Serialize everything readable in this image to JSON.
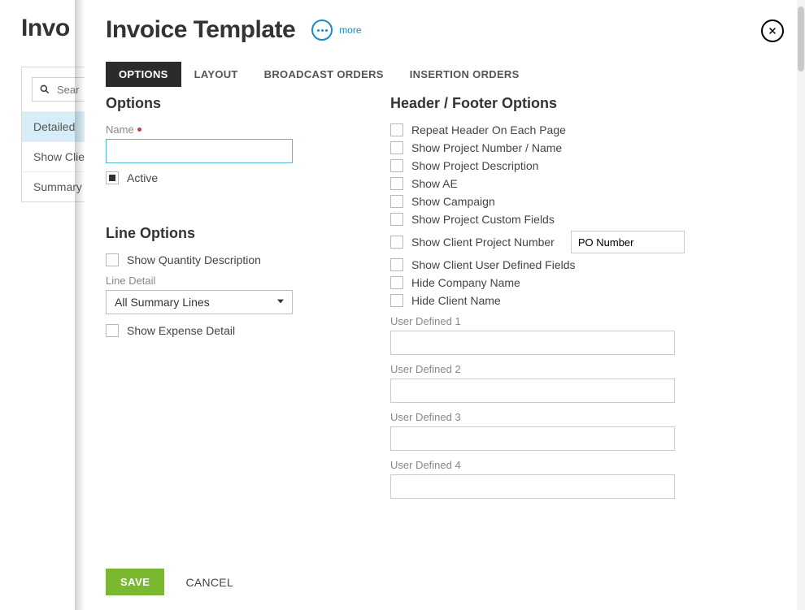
{
  "background": {
    "title": "Invo",
    "search_placeholder": "Sear",
    "items": [
      "Detailed",
      "Show Client",
      "Summary"
    ],
    "selected_index": 0
  },
  "modal": {
    "title": "Invoice Template",
    "more_label": "more",
    "tabs": [
      "OPTIONS",
      "LAYOUT",
      "BROADCAST ORDERS",
      "INSERTION ORDERS"
    ],
    "active_tab": 0,
    "options": {
      "heading": "Options",
      "name_label": "Name",
      "name_value": "",
      "active_label": "Active",
      "active_checked": true
    },
    "line_options": {
      "heading": "Line Options",
      "show_qty_label": "Show Quantity Description",
      "show_qty_checked": false,
      "line_detail_label": "Line Detail",
      "line_detail_value": "All Summary Lines",
      "show_expense_label": "Show Expense Detail",
      "show_expense_checked": false
    },
    "header_footer": {
      "heading": "Header / Footer Options",
      "rows": [
        {
          "key": "repeat_header",
          "label": "Repeat Header On Each Page",
          "checked": false
        },
        {
          "key": "show_proj_num",
          "label": "Show Project Number / Name",
          "checked": false
        },
        {
          "key": "show_proj_desc",
          "label": "Show Project Description",
          "checked": false
        },
        {
          "key": "show_ae",
          "label": "Show AE",
          "checked": false
        },
        {
          "key": "show_campaign",
          "label": "Show Campaign",
          "checked": false
        },
        {
          "key": "show_proj_cf",
          "label": "Show Project Custom Fields",
          "checked": false
        },
        {
          "key": "show_client_projnum",
          "label": "Show Client Project Number",
          "checked": false,
          "extra_input": "PO Number"
        },
        {
          "key": "show_client_udf",
          "label": "Show Client User Defined Fields",
          "checked": false
        },
        {
          "key": "hide_company",
          "label": "Hide Company Name",
          "checked": false
        },
        {
          "key": "hide_client",
          "label": "Hide Client Name",
          "checked": false
        }
      ],
      "user_defined": [
        {
          "label": "User Defined 1",
          "value": ""
        },
        {
          "label": "User Defined 2",
          "value": ""
        },
        {
          "label": "User Defined 3",
          "value": ""
        },
        {
          "label": "User Defined 4",
          "value": ""
        }
      ]
    },
    "buttons": {
      "save": "SAVE",
      "cancel": "CANCEL"
    }
  }
}
